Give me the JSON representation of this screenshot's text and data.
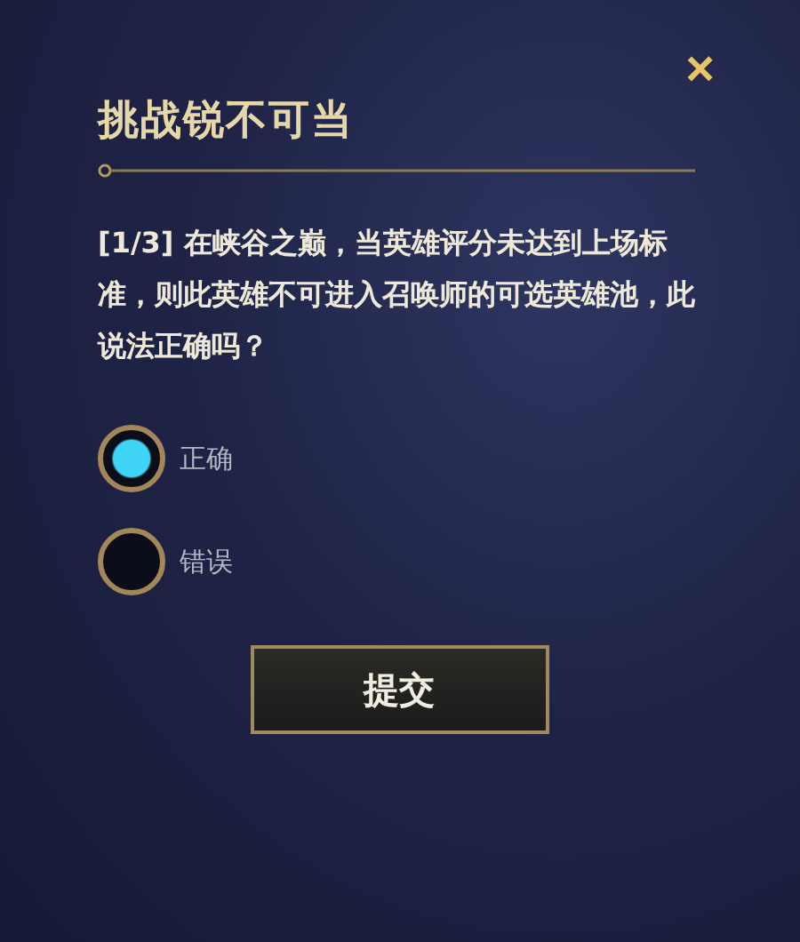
{
  "dialog": {
    "title": "挑战锐不可当",
    "close": "×",
    "question": "[1/3] 在峡谷之巅，当英雄评分未达到上场标准，则此英雄不可进入召唤师的可选英雄池，此说法正确吗？",
    "options": [
      {
        "label": "正确",
        "selected": true
      },
      {
        "label": "错误",
        "selected": false
      }
    ],
    "submit": "提交"
  }
}
